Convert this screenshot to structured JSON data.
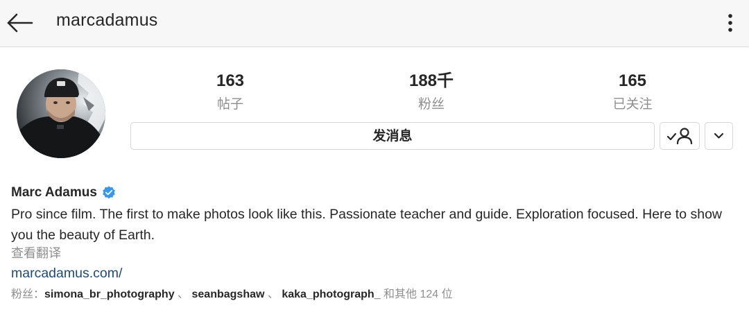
{
  "header": {
    "back_icon": "arrow-left-icon",
    "username": "marcadamus",
    "more_icon": "vertical-dots-icon"
  },
  "profile": {
    "avatar_alt": "profile-photo",
    "stats": [
      {
        "value": "163",
        "label": "帖子"
      },
      {
        "value": "188千",
        "label": "粉丝"
      },
      {
        "value": "165",
        "label": "已关注"
      }
    ],
    "message_button": "发消息",
    "following_icon": "user-check-icon",
    "dropdown_icon": "chevron-down-icon"
  },
  "bio": {
    "full_name": "Marc Adamus",
    "verified_icon": "verified-badge-icon",
    "text": "Pro since film.  The first to make photos look like this.  Passionate teacher and guide.  Exploration focused.  Here to show you the beauty of Earth.",
    "translate": "查看翻译",
    "website": "marcadamus.com/"
  },
  "followed_by": {
    "prefix": "粉丝：",
    "accounts": [
      "simona_br_photography",
      "seanbagshaw",
      "kaka_photograph_"
    ],
    "separator": " 、 ",
    "suffix": " 和其他 124 位"
  },
  "colors": {
    "accent_blue": "#3897f0",
    "link": "#1c4a7a",
    "muted_text": "#8e8e8e",
    "primary_text": "#262626",
    "topbar_bg": "#f7f7f7"
  }
}
